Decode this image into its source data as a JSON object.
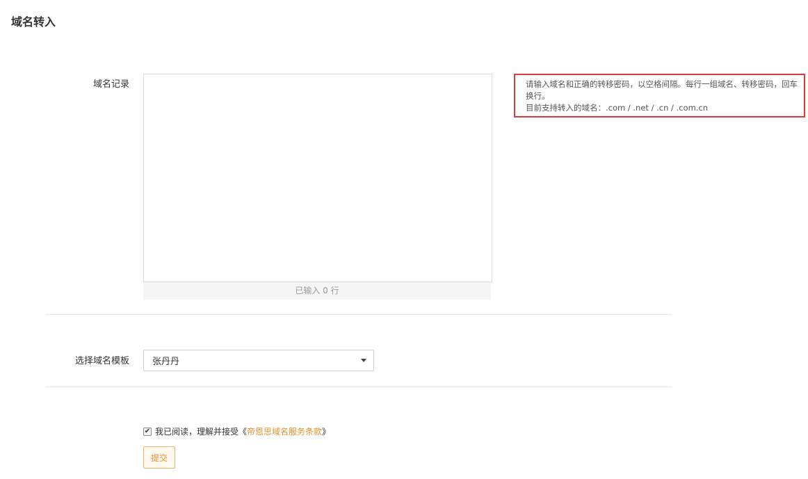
{
  "page": {
    "title": "域名转入"
  },
  "records": {
    "label": "域名记录",
    "value": "",
    "line_count_text": "已输入 0 行"
  },
  "hint": {
    "line1": "请输入域名和正确的转移密码，以空格间隔。每行一组域名、转移密码，回车换行。",
    "line2": "目前支持转入的域名：.com / .net / .cn / .com.cn",
    "border_color": "#e23a3a"
  },
  "template": {
    "label": "选择域名模板",
    "selected": "张丹丹",
    "icon": "chevron-down-icon"
  },
  "agreement": {
    "checked": true,
    "prefix": "我已阅读，理解并接受",
    "open_quote": "《",
    "link_text": "帝恩思域名服务条款",
    "close_quote": "》",
    "link_color": "#e8912f"
  },
  "submit": {
    "label": "提交"
  }
}
